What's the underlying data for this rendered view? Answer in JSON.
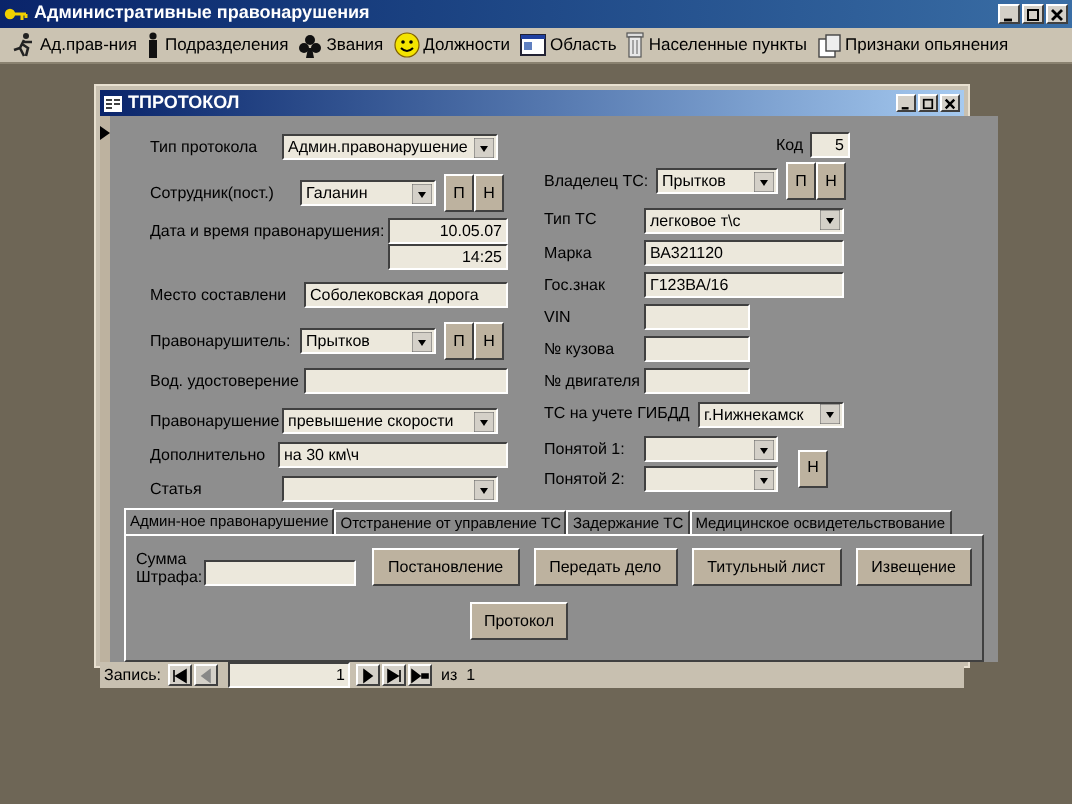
{
  "window": {
    "title": "Административные правонарушения"
  },
  "toolbar": [
    {
      "kind": "runner",
      "label": "Ад.прав-ния"
    },
    {
      "kind": "person",
      "label": "Подразделения"
    },
    {
      "kind": "club",
      "label": "Звания"
    },
    {
      "kind": "smiley",
      "label": "Должности"
    },
    {
      "kind": "window",
      "label": "Область"
    },
    {
      "kind": "bin",
      "label": "Населенные пункты"
    },
    {
      "kind": "doc",
      "label": "Признаки опьянения"
    }
  ],
  "form": {
    "title": "ТПРОТОКОЛ",
    "left_fields": [
      {
        "kind": "combo",
        "label": "Тип протокола",
        "value": "Админ.правонарушение"
      },
      {
        "kind": "combo_pn",
        "label": "Сотрудник(пост.)",
        "value": "Галанин",
        "buttons": [
          "П",
          "Н"
        ]
      },
      {
        "kind": "datetime",
        "label": "Дата  и время правонарушения:",
        "date": "10.05.07",
        "time": "14:25"
      },
      {
        "kind": "text",
        "label": "Место составлени",
        "value": "Соболековская дорога"
      },
      {
        "kind": "combo_pn",
        "label": "Правонарушитель:",
        "value": "Прытков",
        "buttons": [
          "П",
          "Н"
        ]
      },
      {
        "kind": "text",
        "label": "Вод. удостоверение"
      },
      {
        "kind": "combo",
        "label": "Правонарушение",
        "value": "превышение скорости"
      },
      {
        "kind": "text",
        "label": "Дополнительно",
        "value": "на 30 км\\ч"
      },
      {
        "kind": "combo",
        "label": "Статья"
      }
    ],
    "code": {
      "label": "Код",
      "value": "5"
    },
    "right_fields": [
      {
        "kind": "combo_pn",
        "label": "Владелец ТС:",
        "value": "Прытков",
        "buttons": [
          "П",
          "Н"
        ]
      },
      {
        "kind": "combo",
        "label": "Тип ТС",
        "value": "легковое т\\с"
      },
      {
        "kind": "text",
        "label": "Марка",
        "value": "ВА321120"
      },
      {
        "kind": "text",
        "label": "Гос.знак",
        "value": "Г123ВА/16"
      },
      {
        "kind": "short",
        "label": "VIN"
      },
      {
        "kind": "short",
        "label": "№ кузова"
      },
      {
        "kind": "short",
        "label": "№ двигателя"
      },
      {
        "kind": "combo",
        "label": "ТС на учете ГИБДД",
        "value": "г.Нижнекамск"
      }
    ],
    "witnesses": {
      "rows": [
        {
          "label": "Понятой 1:"
        },
        {
          "label": "Понятой 2:"
        }
      ],
      "button": "Н"
    },
    "tabs": [
      {
        "label": "Админ-ное правонарушение",
        "selected": true
      },
      {
        "label": "Отстранение от управление ТС",
        "selected": false
      },
      {
        "label": "Задержание ТС",
        "selected": false
      },
      {
        "label": "Медицинское освидетельствование",
        "selected": false
      }
    ],
    "tab_panel": {
      "fine_label": "Сумма Штрафа:",
      "buttons": [
        "Постановление",
        "Передать дело",
        "Титульный лист",
        "Извещение"
      ],
      "bottom_button": "Протокол"
    },
    "record_nav": {
      "label": "Запись:",
      "value": "1",
      "of": "из  1"
    }
  }
}
